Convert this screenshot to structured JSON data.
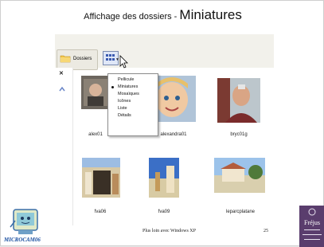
{
  "slide": {
    "title_prefix": "Affichage des dossiers - ",
    "title_main": "Miniatures",
    "footer_text": "Plus loin avec Windows XP",
    "page_number": "25",
    "logo_left_text": "MICROCAM06",
    "logo_right_text": "Fréjus"
  },
  "toolbar": {
    "folders_label": "Dossiers"
  },
  "view_menu": {
    "items": [
      "Pellicule",
      "Miniatures",
      "Mosaïques",
      "Icônes",
      "Liste",
      "Détails"
    ],
    "selected_index": 1
  },
  "thumbnails": [
    {
      "caption": "alex01"
    },
    {
      "caption": "alexandra01"
    },
    {
      "caption": "bryc01g"
    },
    {
      "caption": "fva06"
    },
    {
      "caption": "fva09"
    },
    {
      "caption": "leparcplatane"
    }
  ],
  "colors": {
    "accent_blue": "#1a4fa0",
    "toolbar_bg": "#f2f1eb",
    "frejus_bg": "#5a3d6d"
  }
}
